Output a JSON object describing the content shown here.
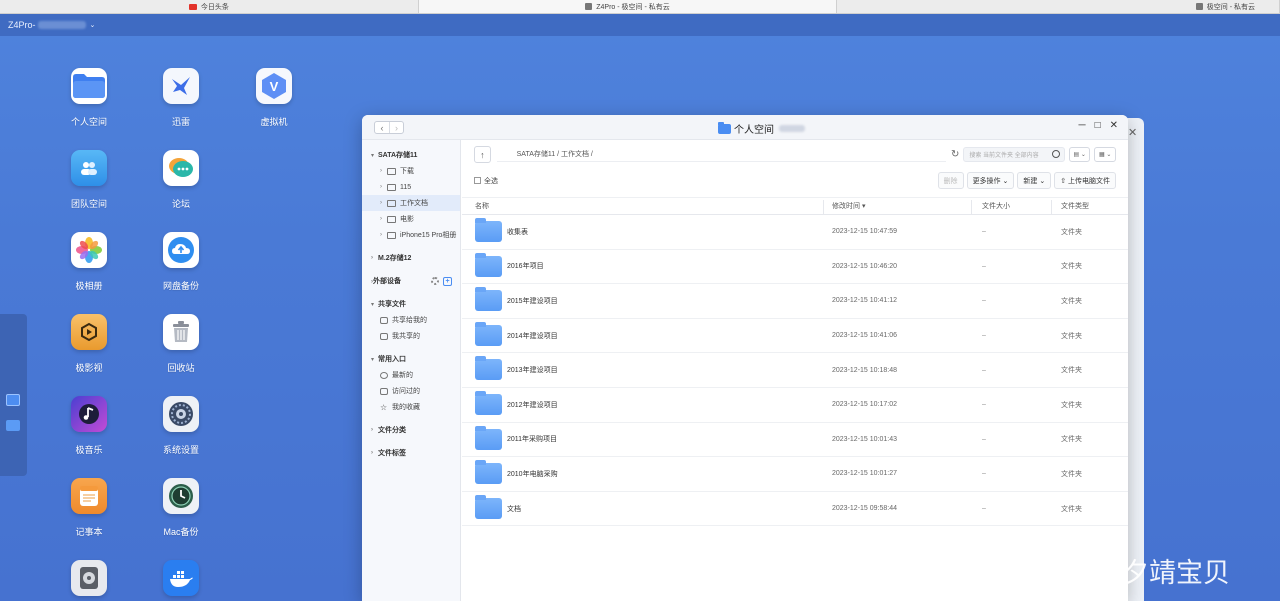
{
  "browser_tabs": [
    {
      "label": "今日头条"
    },
    {
      "label": "Z4Pro - 极空间 - 私有云"
    },
    {
      "label": "极空间 - 私有云"
    }
  ],
  "topbar": {
    "device_name": "Z4Pro-",
    "caret": "⌄"
  },
  "desktop_icons": [
    {
      "label": "个人空间"
    },
    {
      "label": "迅雷"
    },
    {
      "label": "虚拟机"
    },
    {
      "label": "团队空间"
    },
    {
      "label": "论坛"
    },
    {
      "label": "极相册"
    },
    {
      "label": "网盘备份"
    },
    {
      "label": "极影视"
    },
    {
      "label": "回收站"
    },
    {
      "label": "极音乐"
    },
    {
      "label": "系统设置"
    },
    {
      "label": "记事本"
    },
    {
      "label": "Mac备份"
    }
  ],
  "window": {
    "title": "个人空间",
    "controls": {
      "minimize": "─",
      "maximize": "□",
      "close": "✕"
    },
    "nav": {
      "back": "‹",
      "forward": "›"
    }
  },
  "sidebar": {
    "storage1": "SATA存储11",
    "folders": [
      "下载",
      "115",
      "工作文档",
      "电影",
      "iPhone15 Pro相册"
    ],
    "storage2": "M.2存储12",
    "external": "外部设备",
    "shared": "共享文件",
    "shared_items": [
      "共享给我的",
      "我共享的"
    ],
    "quick": "常用入口",
    "quick_items": [
      "最新的",
      "访问过的",
      "我的收藏"
    ],
    "categories": "文件分类",
    "tags": "文件标签"
  },
  "pathbar": {
    "up": "↑",
    "path": "SATA存储11 / 工作文档 /",
    "refresh": "↻",
    "search_placeholder": "搜索 当前文件夹 全部内容"
  },
  "toolbar": {
    "select_all": "全选",
    "delete": "删除",
    "more": "更多操作 ⌄",
    "new": "新建 ⌄",
    "upload": "⇧ 上传电脑文件"
  },
  "table": {
    "headers": {
      "name": "名称",
      "modified": "修改时间 ▾",
      "size": "文件大小",
      "type": "文件类型"
    },
    "rows": [
      {
        "name": "收集表",
        "modified": "2023-12-15 10:47:59",
        "size": "–",
        "type": "文件夹"
      },
      {
        "name": "2016年项目",
        "modified": "2023-12-15 10:46:20",
        "size": "–",
        "type": "文件夹"
      },
      {
        "name": "2015年建设项目",
        "modified": "2023-12-15 10:41:12",
        "size": "–",
        "type": "文件夹"
      },
      {
        "name": "2014年建设项目",
        "modified": "2023-12-15 10:41:06",
        "size": "–",
        "type": "文件夹"
      },
      {
        "name": "2013年建设项目",
        "modified": "2023-12-15 10:18:48",
        "size": "–",
        "type": "文件夹"
      },
      {
        "name": "2012年建设项目",
        "modified": "2023-12-15 10:17:02",
        "size": "–",
        "type": "文件夹"
      },
      {
        "name": "2011年采购项目",
        "modified": "2023-12-15 10:01:43",
        "size": "–",
        "type": "文件夹"
      },
      {
        "name": "2010年电脑采购",
        "modified": "2023-12-15 10:01:27",
        "size": "–",
        "type": "文件夹"
      },
      {
        "name": "文档",
        "modified": "2023-12-15 09:58:44",
        "size": "–",
        "type": "文件夹"
      }
    ]
  },
  "watermark": {
    "text": "@小夕靖宝贝"
  },
  "colors": {
    "desktop": "#4a7ad6",
    "accent": "#4a8df2",
    "folder": "#6aa6f7"
  }
}
